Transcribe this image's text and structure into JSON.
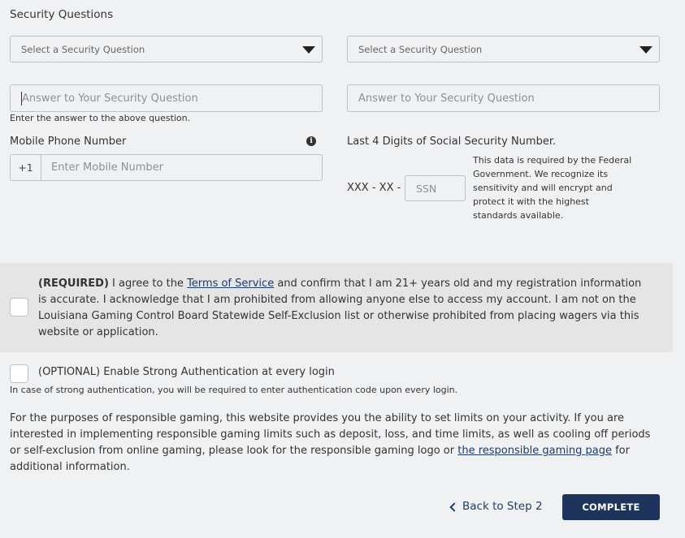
{
  "section_title": "Security Questions",
  "security_questions": [
    {
      "select_placeholder": "Select a Security Question",
      "answer_placeholder": "Answer to Your Security Question"
    },
    {
      "select_placeholder": "Select a Security Question",
      "answer_placeholder": "Answer to Your Security Question"
    }
  ],
  "answer_hint": "Enter the answer to the above question.",
  "mobile": {
    "label": "Mobile Phone Number",
    "prefix": "+1",
    "placeholder": "Enter Mobile Number",
    "info_icon": "info-icon"
  },
  "ssn": {
    "label": "Last 4 Digits of Social Security Number.",
    "prefix": "XXX - XX -",
    "placeholder": "SSN",
    "note": "This data is required by the Federal Government. We recognize its sensitivity and will encrypt and protect it with the highest standards available."
  },
  "required_agreement": {
    "bold_prefix": "(REQUIRED)",
    "text_before_link": " I agree to the ",
    "link_text": "Terms of Service",
    "text_after_link": " and confirm that I am 21+ years old and my registration information is accurate. I acknowledge that I am prohibited from allowing anyone else to access my account. I am not on the Louisiana Gaming Control Board Statewide Self-Exclusion list or otherwise prohibited from placing wagers via this website or application."
  },
  "optional_auth": {
    "label": "(OPTIONAL) Enable Strong Authentication at every login",
    "hint": "In case of strong authentication, you will be required to enter authentication code upon every login."
  },
  "responsible_gaming": {
    "text_before_link": "For the purposes of responsible gaming, this website provides you the ability to set limits on your activity. If you are interested in implementing responsible gaming limits such as deposit, loss, and time limits, as well as cooling off periods or self-exclusion from online gaming, please look for the responsible gaming logo or ",
    "link_text": "the responsible gaming page",
    "text_after_link": " for additional information."
  },
  "footer": {
    "back_label": "Back to Step 2",
    "complete_label": "COMPLETE"
  },
  "colors": {
    "background": "#f0f1f3",
    "band": "#e6e5e6",
    "primary": "#1d355c",
    "link": "#1f3c68"
  }
}
